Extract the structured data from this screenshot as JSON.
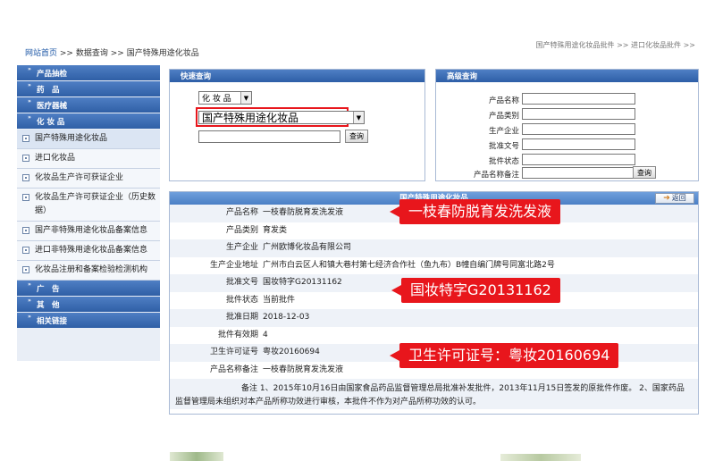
{
  "breadcrumb": {
    "home": "网站首页",
    "sep": ">>",
    "level2": "数据查询",
    "level3": "国产特殊用途化妆品"
  },
  "top_links": "国产特殊用途化妆品批件 >>   进口化妆品批件 >>",
  "sidebar": {
    "groups": [
      {
        "label": "产品抽检"
      },
      {
        "label": "药　品"
      },
      {
        "label": "医疗器械"
      },
      {
        "label": "化 妆 品"
      }
    ],
    "cosmetic_items": [
      {
        "label": "国产特殊用途化妆品",
        "active": true
      },
      {
        "label": "进口化妆品"
      },
      {
        "label": "化妆品生产许可获证企业"
      },
      {
        "label": "化妆品生产许可获证企业（历史数据）"
      },
      {
        "label": "国产非特殊用途化妆品备案信息"
      },
      {
        "label": "进口非特殊用途化妆品备案信息"
      },
      {
        "label": "化妆品注册和备案检验检测机构"
      }
    ],
    "groups_after": [
      {
        "label": "广　告"
      },
      {
        "label": "其　他"
      },
      {
        "label": "相关链接"
      }
    ]
  },
  "quick_search": {
    "title": "快速查询",
    "category_select": "化 妆 品",
    "subcategory_select": "国产特殊用途化妆品",
    "keyword_value": "",
    "button": "查询"
  },
  "advanced_search": {
    "title": "高级查询",
    "fields": [
      {
        "label": "产品名称"
      },
      {
        "label": "产品类别"
      },
      {
        "label": "生产企业"
      },
      {
        "label": "批准文号"
      },
      {
        "label": "批件状态"
      },
      {
        "label": "产品名称备注"
      }
    ],
    "button": "查询"
  },
  "detail": {
    "title": "国产特殊用途化妆品",
    "back": "返回",
    "rows": [
      {
        "key": "产品名称",
        "value": "一枝春防脱育发洗发液"
      },
      {
        "key": "产品类别",
        "value": "育发类"
      },
      {
        "key": "生产企业",
        "value": "广州欧博化妆品有限公司"
      },
      {
        "key": "生产企业地址",
        "value": "广州市白云区人和镇大巷村第七经济合作社（鱼九布）B幢自编门牌号同富北路2号"
      },
      {
        "key": "批准文号",
        "value": "国妆特字G20131162"
      },
      {
        "key": "批件状态",
        "value": "当前批件"
      },
      {
        "key": "批准日期",
        "value": "2018-12-03"
      },
      {
        "key": "批件有效期",
        "value": "4"
      },
      {
        "key": "卫生许可证号",
        "value": "粤妆20160694"
      },
      {
        "key": "产品名称备注",
        "value": "一枝春防脱育发洗发液"
      }
    ],
    "remark_key": "备注",
    "remark_value": "1、2015年10月16日由国家食品药品监督管理总局批准补发批件，2013年11月15日签发的原批件作废。 2、国家药品监督管理局未组织对本产品所称功效进行审核，本批件不作为对产品所称功效的认可。"
  },
  "callouts": {
    "product": "一枝春防脱育发洗发液",
    "approval": "国妆特字G20131162",
    "license": "卫生许可证号：粤妆20160694"
  },
  "colors": {
    "nav_blue": "#2f5fa6",
    "callout_red": "#e8161c",
    "highlight_box": "#e8161c"
  }
}
